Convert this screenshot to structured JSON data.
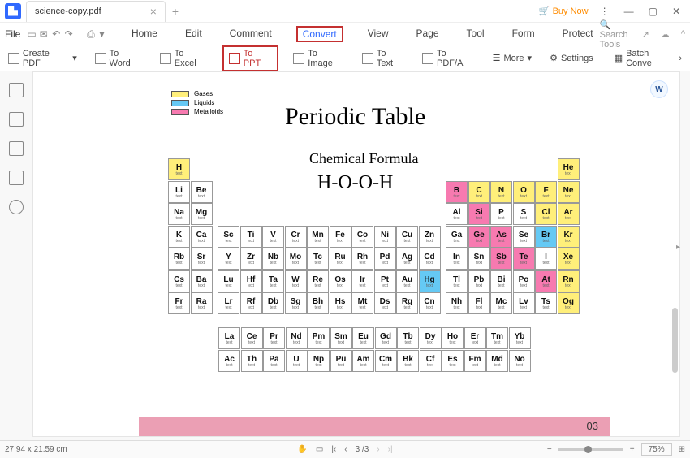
{
  "window": {
    "title": "science-copy.pdf",
    "buynow": "Buy Now"
  },
  "menu": {
    "file": "File",
    "items": [
      "Home",
      "Edit",
      "Comment",
      "Convert",
      "View",
      "Page",
      "Tool",
      "Form",
      "Protect"
    ],
    "search": "Search Tools"
  },
  "toolbar": {
    "create": "Create PDF",
    "toword": "To Word",
    "toexcel": "To Excel",
    "toppt": "To PPT",
    "toimage": "To Image",
    "totext": "To Text",
    "topdfa": "To PDF/A",
    "more": "More",
    "settings": "Settings",
    "batch": "Batch Conve"
  },
  "doc": {
    "title": "Periodic Table",
    "subtitle": "Chemical Formula",
    "formula": "H-O-O-H",
    "pagenum": "03",
    "legend": {
      "gases": "Gases",
      "liquids": "Liquids",
      "metalloids": "Metalloids"
    }
  },
  "status": {
    "dims": "27.94 x 21.59 cm",
    "page": "3 /3",
    "zoom": "75%"
  },
  "colors": {
    "gases": "#ffef7a",
    "liquids": "#65c9f4",
    "metalloids": "#f77ab0"
  },
  "chart_data": {
    "type": "table",
    "title": "Periodic Table",
    "columns": 18,
    "rows_main": 7,
    "categories": {
      "yellow": "Gases",
      "blue": "Liquids",
      "pink": "Metalloids"
    },
    "elements": [
      {
        "s": "H",
        "r": 1,
        "c": 1,
        "cat": "y"
      },
      {
        "s": "He",
        "r": 1,
        "c": 18,
        "cat": "y"
      },
      {
        "s": "Li",
        "r": 2,
        "c": 1
      },
      {
        "s": "Be",
        "r": 2,
        "c": 2
      },
      {
        "s": "B",
        "r": 2,
        "c": 13,
        "cat": "p"
      },
      {
        "s": "C",
        "r": 2,
        "c": 14,
        "cat": "y"
      },
      {
        "s": "N",
        "r": 2,
        "c": 15,
        "cat": "y"
      },
      {
        "s": "O",
        "r": 2,
        "c": 16,
        "cat": "y"
      },
      {
        "s": "F",
        "r": 2,
        "c": 17,
        "cat": "y"
      },
      {
        "s": "Ne",
        "r": 2,
        "c": 18,
        "cat": "y"
      },
      {
        "s": "Na",
        "r": 3,
        "c": 1
      },
      {
        "s": "Mg",
        "r": 3,
        "c": 2
      },
      {
        "s": "Al",
        "r": 3,
        "c": 13
      },
      {
        "s": "Si",
        "r": 3,
        "c": 14,
        "cat": "p"
      },
      {
        "s": "P",
        "r": 3,
        "c": 15
      },
      {
        "s": "S",
        "r": 3,
        "c": 16
      },
      {
        "s": "Cl",
        "r": 3,
        "c": 17,
        "cat": "y"
      },
      {
        "s": "Ar",
        "r": 3,
        "c": 18,
        "cat": "y"
      },
      {
        "s": "K",
        "r": 4,
        "c": 1
      },
      {
        "s": "Ca",
        "r": 4,
        "c": 2
      },
      {
        "s": "Sc",
        "r": 4,
        "c": 3
      },
      {
        "s": "Ti",
        "r": 4,
        "c": 4
      },
      {
        "s": "V",
        "r": 4,
        "c": 5
      },
      {
        "s": "Cr",
        "r": 4,
        "c": 6
      },
      {
        "s": "Mn",
        "r": 4,
        "c": 7
      },
      {
        "s": "Fe",
        "r": 4,
        "c": 8
      },
      {
        "s": "Co",
        "r": 4,
        "c": 9
      },
      {
        "s": "Ni",
        "r": 4,
        "c": 10
      },
      {
        "s": "Cu",
        "r": 4,
        "c": 11
      },
      {
        "s": "Zn",
        "r": 4,
        "c": 12
      },
      {
        "s": "Ga",
        "r": 4,
        "c": 13
      },
      {
        "s": "Ge",
        "r": 4,
        "c": 14,
        "cat": "p"
      },
      {
        "s": "As",
        "r": 4,
        "c": 15,
        "cat": "p"
      },
      {
        "s": "Se",
        "r": 4,
        "c": 16
      },
      {
        "s": "Br",
        "r": 4,
        "c": 17,
        "cat": "b"
      },
      {
        "s": "Kr",
        "r": 4,
        "c": 18,
        "cat": "y"
      },
      {
        "s": "Rb",
        "r": 5,
        "c": 1
      },
      {
        "s": "Sr",
        "r": 5,
        "c": 2
      },
      {
        "s": "Y",
        "r": 5,
        "c": 3
      },
      {
        "s": "Zr",
        "r": 5,
        "c": 4
      },
      {
        "s": "Nb",
        "r": 5,
        "c": 5
      },
      {
        "s": "Mo",
        "r": 5,
        "c": 6
      },
      {
        "s": "Tc",
        "r": 5,
        "c": 7
      },
      {
        "s": "Ru",
        "r": 5,
        "c": 8
      },
      {
        "s": "Rh",
        "r": 5,
        "c": 9
      },
      {
        "s": "Pd",
        "r": 5,
        "c": 10
      },
      {
        "s": "Ag",
        "r": 5,
        "c": 11
      },
      {
        "s": "Cd",
        "r": 5,
        "c": 12
      },
      {
        "s": "In",
        "r": 5,
        "c": 13
      },
      {
        "s": "Sn",
        "r": 5,
        "c": 14
      },
      {
        "s": "Sb",
        "r": 5,
        "c": 15,
        "cat": "p"
      },
      {
        "s": "Te",
        "r": 5,
        "c": 16,
        "cat": "p"
      },
      {
        "s": "I",
        "r": 5,
        "c": 17
      },
      {
        "s": "Xe",
        "r": 5,
        "c": 18,
        "cat": "y"
      },
      {
        "s": "Cs",
        "r": 6,
        "c": 1
      },
      {
        "s": "Ba",
        "r": 6,
        "c": 2
      },
      {
        "s": "Lu",
        "r": 6,
        "c": 3
      },
      {
        "s": "Hf",
        "r": 6,
        "c": 4
      },
      {
        "s": "Ta",
        "r": 6,
        "c": 5
      },
      {
        "s": "W",
        "r": 6,
        "c": 6
      },
      {
        "s": "Re",
        "r": 6,
        "c": 7
      },
      {
        "s": "Os",
        "r": 6,
        "c": 8
      },
      {
        "s": "Ir",
        "r": 6,
        "c": 9
      },
      {
        "s": "Pt",
        "r": 6,
        "c": 10
      },
      {
        "s": "Au",
        "r": 6,
        "c": 11
      },
      {
        "s": "Hg",
        "r": 6,
        "c": 12,
        "cat": "b"
      },
      {
        "s": "Tl",
        "r": 6,
        "c": 13
      },
      {
        "s": "Pb",
        "r": 6,
        "c": 14
      },
      {
        "s": "Bi",
        "r": 6,
        "c": 15
      },
      {
        "s": "Po",
        "r": 6,
        "c": 16
      },
      {
        "s": "At",
        "r": 6,
        "c": 17,
        "cat": "p"
      },
      {
        "s": "Rn",
        "r": 6,
        "c": 18,
        "cat": "y"
      },
      {
        "s": "Fr",
        "r": 7,
        "c": 1
      },
      {
        "s": "Ra",
        "r": 7,
        "c": 2
      },
      {
        "s": "Lr",
        "r": 7,
        "c": 3
      },
      {
        "s": "Rf",
        "r": 7,
        "c": 4
      },
      {
        "s": "Db",
        "r": 7,
        "c": 5
      },
      {
        "s": "Sg",
        "r": 7,
        "c": 6
      },
      {
        "s": "Bh",
        "r": 7,
        "c": 7
      },
      {
        "s": "Hs",
        "r": 7,
        "c": 8
      },
      {
        "s": "Mt",
        "r": 7,
        "c": 9
      },
      {
        "s": "Ds",
        "r": 7,
        "c": 10
      },
      {
        "s": "Rg",
        "r": 7,
        "c": 11
      },
      {
        "s": "Cn",
        "r": 7,
        "c": 12
      },
      {
        "s": "Nh",
        "r": 7,
        "c": 13
      },
      {
        "s": "Fl",
        "r": 7,
        "c": 14
      },
      {
        "s": "Mc",
        "r": 7,
        "c": 15
      },
      {
        "s": "Lv",
        "r": 7,
        "c": 16
      },
      {
        "s": "Ts",
        "r": 7,
        "c": 17
      },
      {
        "s": "Og",
        "r": 7,
        "c": 18,
        "cat": "y"
      }
    ],
    "lanthanides": [
      {
        "s": "La"
      },
      {
        "s": "Ce"
      },
      {
        "s": "Pr"
      },
      {
        "s": "Nd"
      },
      {
        "s": "Pm"
      },
      {
        "s": "Sm"
      },
      {
        "s": "Eu"
      },
      {
        "s": "Gd"
      },
      {
        "s": "Tb"
      },
      {
        "s": "Dy"
      },
      {
        "s": "Ho"
      },
      {
        "s": "Er"
      },
      {
        "s": "Tm"
      },
      {
        "s": "Yb"
      }
    ],
    "actinides": [
      {
        "s": "Ac"
      },
      {
        "s": "Th"
      },
      {
        "s": "Pa"
      },
      {
        "s": "U"
      },
      {
        "s": "Np"
      },
      {
        "s": "Pu"
      },
      {
        "s": "Am"
      },
      {
        "s": "Cm"
      },
      {
        "s": "Bk"
      },
      {
        "s": "Cf"
      },
      {
        "s": "Es"
      },
      {
        "s": "Fm"
      },
      {
        "s": "Md"
      },
      {
        "s": "No"
      }
    ]
  }
}
